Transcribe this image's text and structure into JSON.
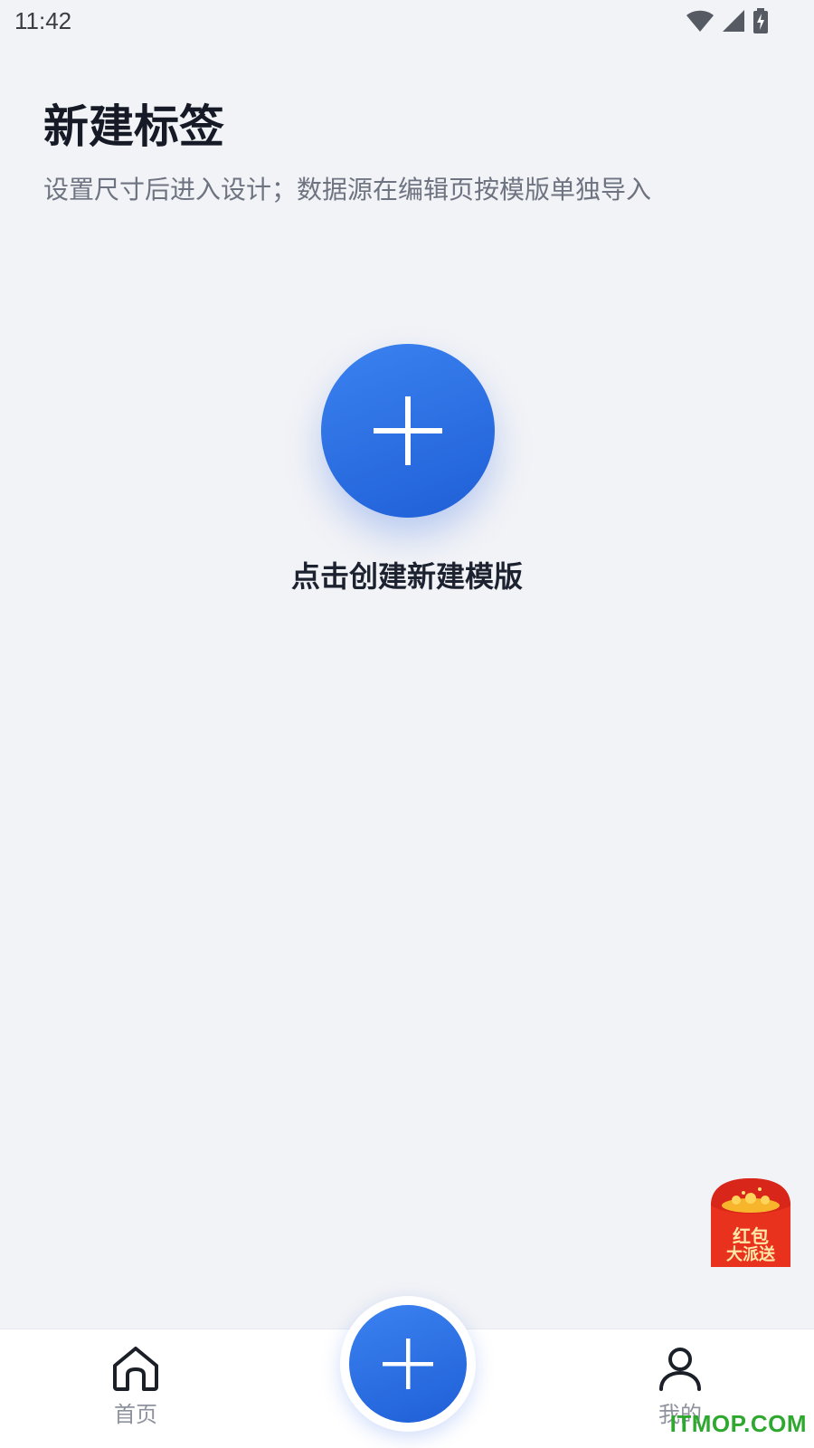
{
  "status_bar": {
    "time": "11:42",
    "icons": [
      "wifi-icon",
      "signal-icon",
      "battery-charging-icon"
    ]
  },
  "header": {
    "title": "新建标签",
    "subtitle": "设置尺寸后进入设计；数据源在编辑页按模版单独导入"
  },
  "create": {
    "label": "点击创建新建模版",
    "icon": "plus-icon"
  },
  "promo": {
    "text_line1": "红包",
    "text_line2": "大派送"
  },
  "bottom_nav": {
    "home_label": "首页",
    "mine_label": "我的",
    "fab_icon": "plus-icon"
  },
  "watermark": "ITMOP.COM",
  "colors": {
    "accent": "#2f6fe6",
    "background": "#f2f3f6",
    "promo_red": "#e8321e"
  }
}
